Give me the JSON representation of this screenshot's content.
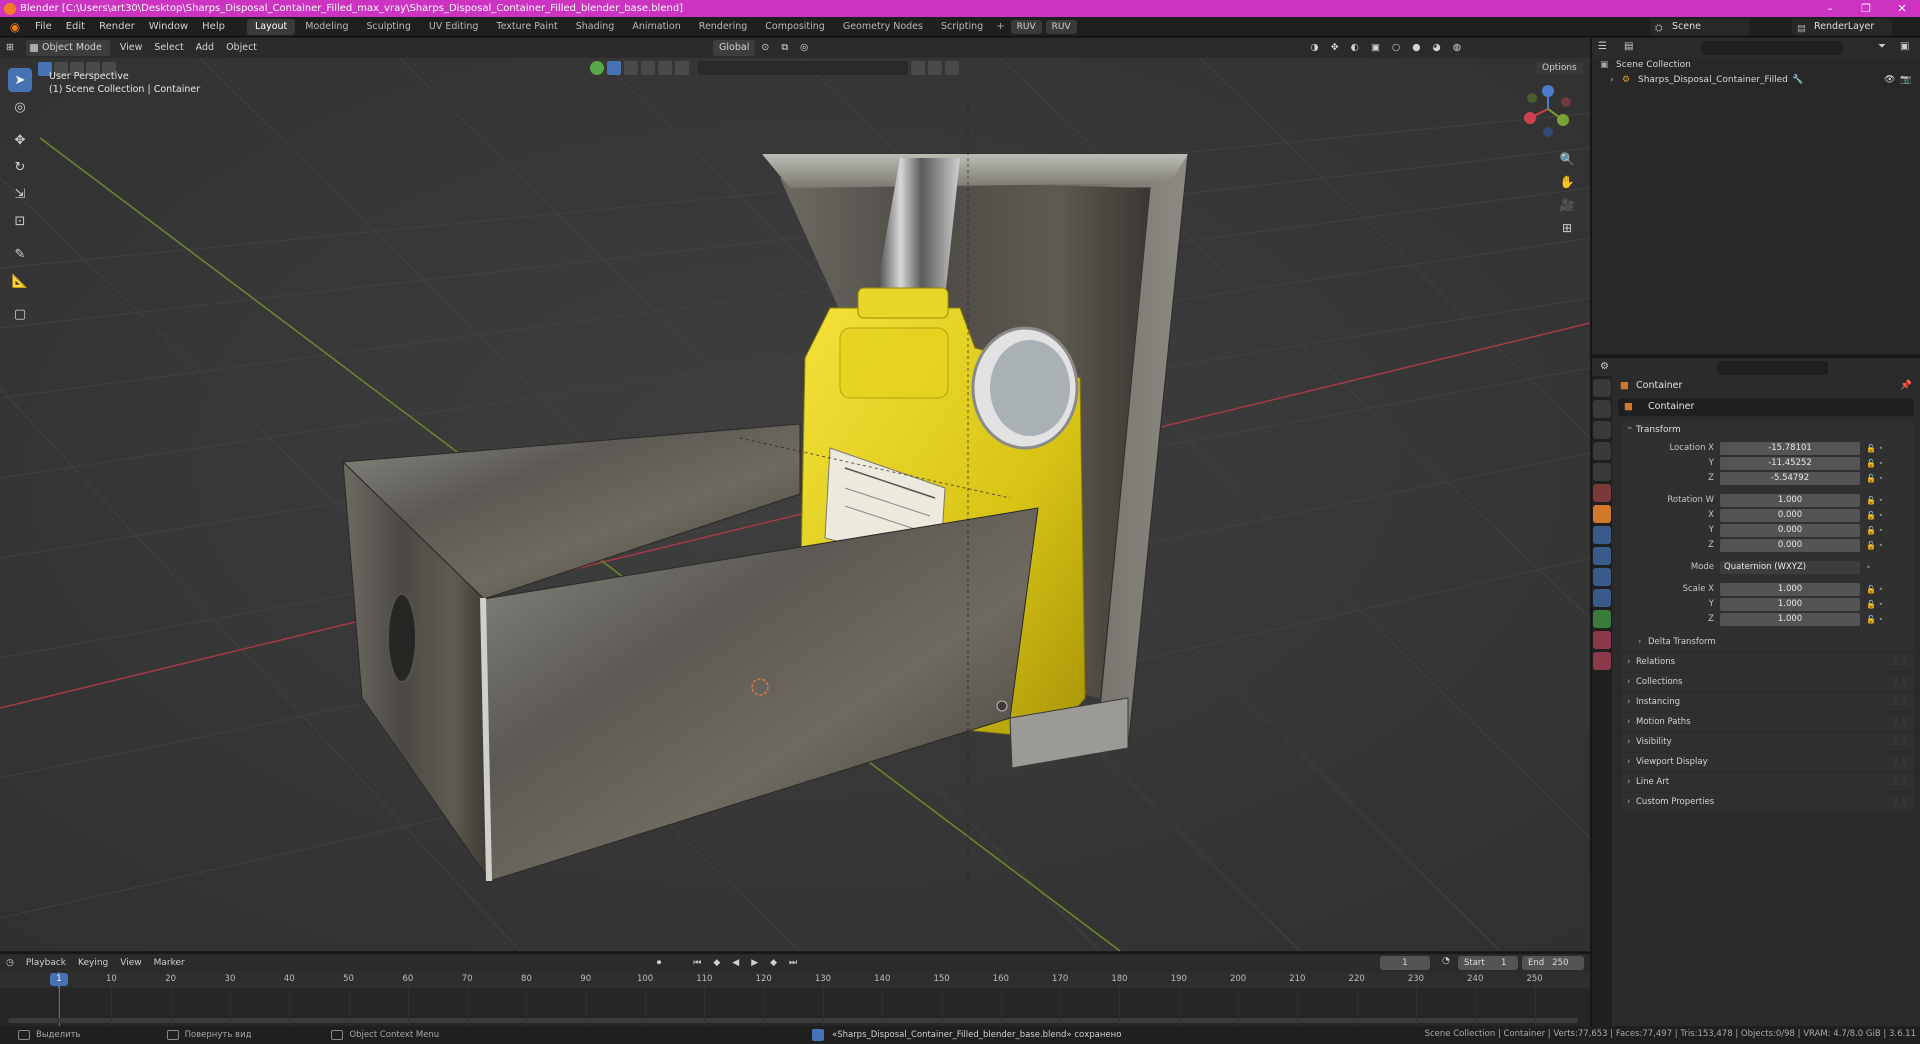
{
  "titlebar": {
    "title": "Blender [C:\\Users\\art30\\Desktop\\Sharps_Disposal_Container_Filled_max_vray\\Sharps_Disposal_Container_Filled_blender_base.blend]",
    "minimize": "–",
    "maximize": "❐",
    "close": "✕",
    "color": "#cc33c0"
  },
  "menu": [
    "File",
    "Edit",
    "Render",
    "Window",
    "Help"
  ],
  "workspaces": [
    "Layout",
    "Modeling",
    "Sculpting",
    "UV Editing",
    "Texture Paint",
    "Shading",
    "Animation",
    "Rendering",
    "Compositing",
    "Geometry Nodes",
    "Scripting"
  ],
  "workspace_add": "+",
  "ruv_buttons": [
    "RUV",
    "RUV"
  ],
  "scene": {
    "name": "Scene",
    "render_layer": "RenderLayer"
  },
  "viewport": {
    "mode": "Object Mode",
    "menus": [
      "View",
      "Select",
      "Add",
      "Object"
    ],
    "transform_orientation": "Global",
    "options": "Options",
    "info_line1": "User Perspective",
    "info_line2": "(1) Scene Collection | Container",
    "gizmo": {
      "x": "X",
      "y": "Y",
      "z": "Z"
    },
    "accent": "#4772b3"
  },
  "outliner": {
    "collection": "Scene Collection",
    "object": "Sharps_Disposal_Container_Filled"
  },
  "properties": {
    "object_name": "Container",
    "object_field": "Container",
    "transform_title": "Transform",
    "location": {
      "label_x": "Location X",
      "label_y": "Y",
      "label_z": "Z",
      "x": "-15.78101",
      "y": "-11.45252",
      "z": "-5.54792"
    },
    "rotation": {
      "label_w": "Rotation W",
      "label_x": "X",
      "label_y": "Y",
      "label_z": "Z",
      "w": "1.000",
      "x": "0.000",
      "y": "0.000",
      "z": "0.000"
    },
    "mode_label": "Mode",
    "mode_value": "Quaternion (WXYZ)",
    "scale": {
      "label_x": "Scale X",
      "label_y": "Y",
      "label_z": "Z",
      "x": "1.000",
      "y": "1.000",
      "z": "1.000"
    },
    "delta_transform": "Delta Transform",
    "panels": [
      "Relations",
      "Collections",
      "Instancing",
      "Motion Paths",
      "Visibility",
      "Viewport Display",
      "Line Art",
      "Custom Properties"
    ]
  },
  "timeline": {
    "menus": [
      "Playback",
      "Keying",
      "View",
      "Marker"
    ],
    "current_frame": "1",
    "start_label": "Start",
    "start": "1",
    "end_label": "End",
    "end": "250",
    "ruler": [
      "1",
      "10",
      "20",
      "30",
      "40",
      "50",
      "60",
      "70",
      "80",
      "90",
      "100",
      "110",
      "120",
      "130",
      "140",
      "150",
      "160",
      "170",
      "180",
      "190",
      "200",
      "210",
      "220",
      "230",
      "240",
      "250"
    ]
  },
  "statusbar": {
    "select": "Выделить",
    "rotate": "Повернуть вид",
    "context": "Object Context Menu",
    "message": "«Sharps_Disposal_Container_Filled_blender_base.blend» сохранено",
    "stats": "Scene Collection | Container | Verts:77,653 | Faces:77,497 | Tris:153,478 | Objects:0/98 | VRAM: 4.7/8.0 GiB | 3.6.11"
  }
}
